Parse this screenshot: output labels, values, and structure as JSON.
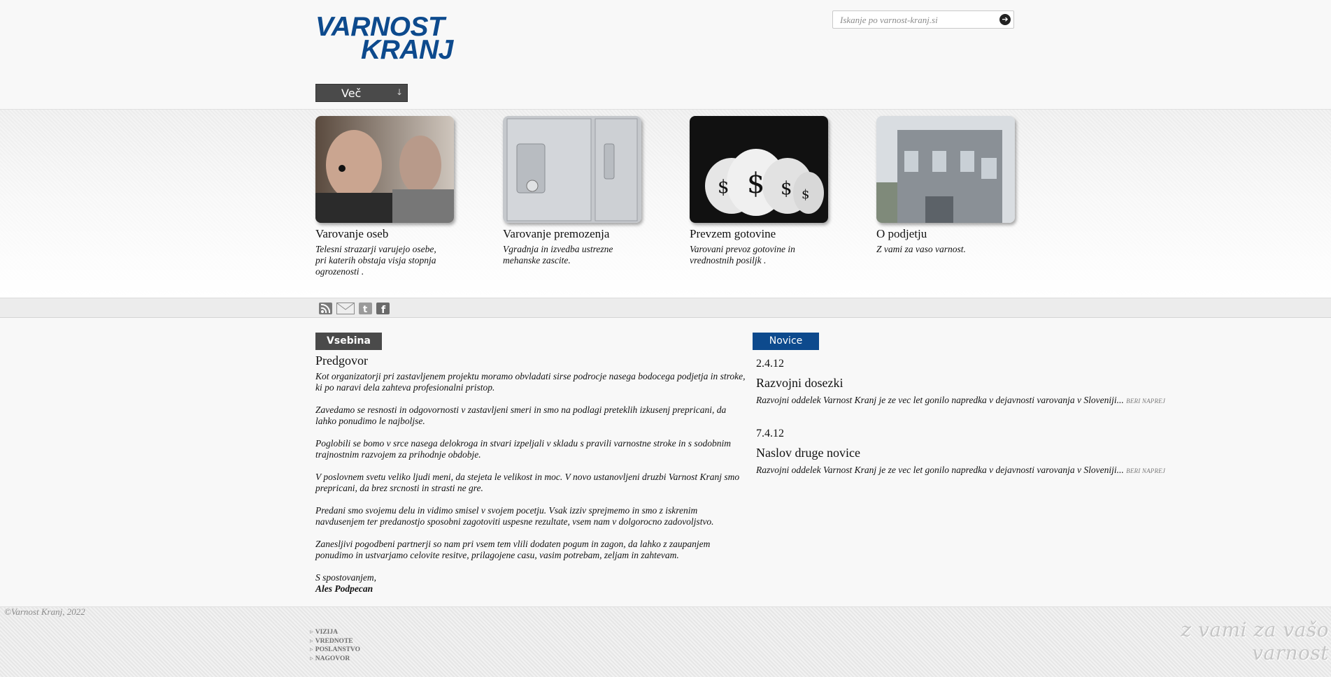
{
  "header": {
    "logo_line1": "VARNOST",
    "logo_line2": "KRANJ",
    "search_placeholder": "Iskanje po varnost-kranj.si",
    "more_menu_label": "Več"
  },
  "colors": {
    "brand_blue": "#0d4a8d",
    "dark_tab": "#4a4a4a"
  },
  "features": [
    {
      "title": "Varovanje oseb",
      "desc": "Telesni strazarji varujejo osebe, pri katerih obstaja visja stopnja ogrozenosti ."
    },
    {
      "title": "Varovanje premozenja",
      "desc": "Vgradnja in izvedba ustrezne mehanske zascite."
    },
    {
      "title": "Prevzem gotovine",
      "desc": "Varovani prevoz gotovine in vrednostnih posiljk ."
    },
    {
      "title": "O podjetju",
      "desc": "Z vami za vaso varnost."
    }
  ],
  "social_icons": [
    "rss-icon",
    "mail-icon",
    "twitter-icon",
    "facebook-icon"
  ],
  "content": {
    "tab_label": "Vsebina",
    "title": "Predgovor",
    "paragraphs": [
      "Kot organizatorji pri zastavljenem projektu moramo obvladati sirse podrocje nasega bodocega podjetja in stroke, ki po naravi dela zahteva profesionalni pristop.",
      "Zavedamo se resnosti in odgovornosti v zastavljeni smeri in smo na podlagi preteklih izkusenj prepricani, da lahko ponudimo le najboljse.",
      "Poglobili se bomo v srce nasega delokroga in stvari izpeljali v skladu s pravili varnostne stroke in s sodobnim trajnostnim razvojem za prihodnje obdobje.",
      "V poslovnem svetu veliko ljudi meni, da stejeta le velikost in moc. V novo ustanovljeni druzbi Varnost Kranj smo prepricani, da brez srcnosti in strasti ne gre.",
      "Predani smo svojemu delu in vidimo smisel v svojem pocetju. Vsak izziv sprejmemo in smo z iskrenim navdusenjem ter predanostjo sposobni zagotoviti uspesne rezultate, vsem nam v dolgorocno zadovoljstvo.",
      "Zanesljivi pogodbeni partnerji so nam pri vsem tem vlili dodaten pogum in zagon, da lahko z zaupanjem ponudimo in ustvarjamo celovite resitve, prilagojene casu, vasim potrebam, zeljam in zahtevam."
    ],
    "signoff": "S spostovanjem,",
    "author": "Ales Podpecan"
  },
  "news": {
    "tab_label": "Novice",
    "items": [
      {
        "date": "2.4.12",
        "title": "Razvojni dosezki",
        "excerpt": "Razvojni oddelek Varnost Kranj je ze vec let gonilo napredka v dejavnosti varovanja v Sloveniji...",
        "more": "BERI NAPREJ"
      },
      {
        "date": "7.4.12",
        "title": "Naslov druge novice",
        "excerpt": "Razvojni oddelek Varnost Kranj je ze vec let gonilo napredka v dejavnosti varovanja v Sloveniji...",
        "more": "BERI NAPREJ"
      }
    ]
  },
  "footer": {
    "copyright": "©Varnost Kranj, 2022",
    "links": [
      "VIZIJA",
      "VREDNOTE",
      "POSLANSTVO",
      "NAGOVOR"
    ],
    "slogan": "z vami za vašo varnost"
  }
}
